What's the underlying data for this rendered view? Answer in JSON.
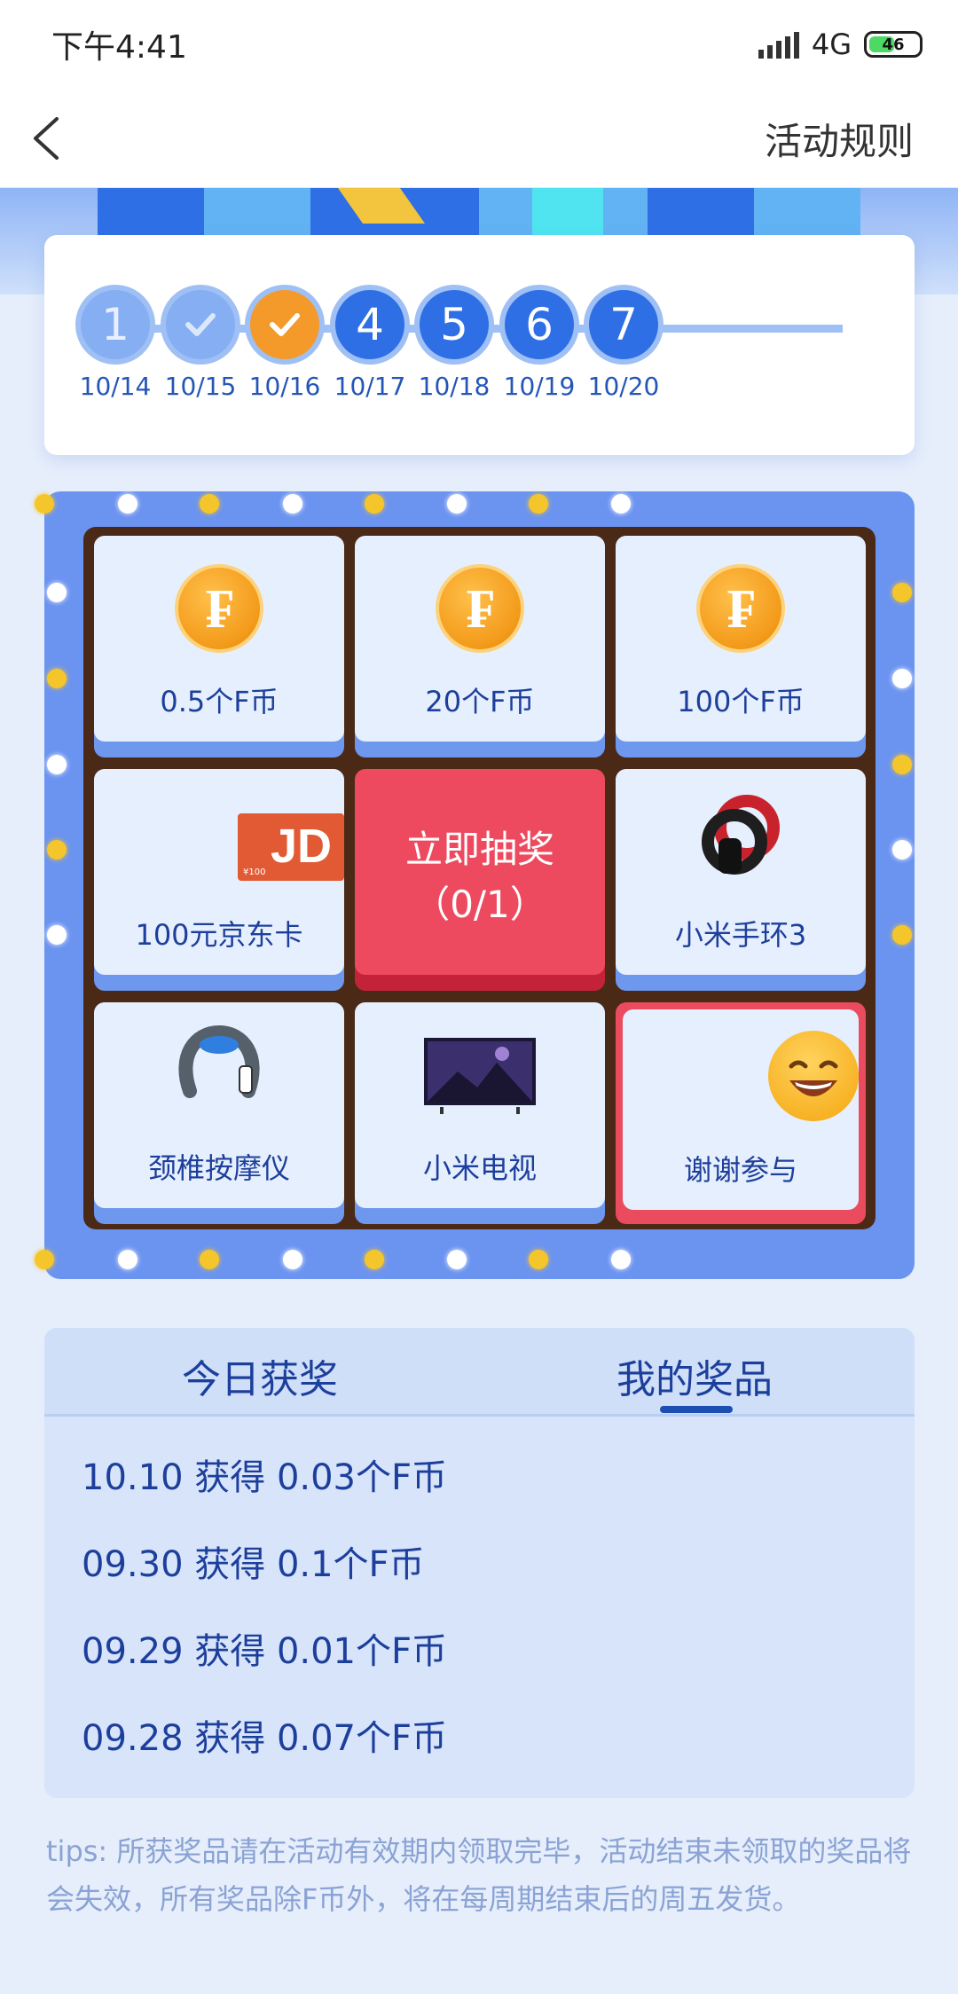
{
  "status_bar": {
    "time": "下午4:41",
    "network": "4G",
    "battery": "46"
  },
  "nav": {
    "rules_label": "活动规则"
  },
  "calendar": {
    "days": [
      {
        "num": "1",
        "date": "10/14",
        "state": "past-number"
      },
      {
        "num": "",
        "date": "10/15",
        "state": "past-check"
      },
      {
        "num": "",
        "date": "10/16",
        "state": "today-check"
      },
      {
        "num": "4",
        "date": "10/17",
        "state": "future"
      },
      {
        "num": "5",
        "date": "10/18",
        "state": "future"
      },
      {
        "num": "6",
        "date": "10/19",
        "state": "future"
      },
      {
        "num": "7",
        "date": "10/20",
        "state": "future"
      }
    ]
  },
  "lottery": {
    "prizes": [
      {
        "label": "0.5个F币",
        "icon": "coin-icon"
      },
      {
        "label": "20个F币",
        "icon": "coin-icon"
      },
      {
        "label": "100个F币",
        "icon": "coin-icon"
      },
      {
        "label": "100元京东卡",
        "icon": "jd-card-icon"
      },
      {
        "label": "小米手环3",
        "icon": "band-icon"
      },
      {
        "label": "颈椎按摩仪",
        "icon": "massager-icon"
      },
      {
        "label": "小米电视",
        "icon": "tv-icon"
      },
      {
        "label": "谢谢参与",
        "icon": "smile-icon"
      }
    ],
    "draw_button": {
      "line1": "立即抽奖",
      "line2": "（0/1）"
    },
    "coin_glyph": "₣",
    "jd_glyph": "JD",
    "jd_small": "¥100"
  },
  "prize_panel": {
    "tabs": [
      "今日获奖",
      "我的奖品"
    ],
    "active_tab": 1,
    "records": [
      "10.10 获得 0.03个F币",
      "09.30 获得 0.1个F币",
      "09.29 获得 0.01个F币",
      "09.28 获得 0.07个F币"
    ]
  },
  "tips": "tips: 所获奖品请在活动有效期内领取完毕，活动结束未领取的奖品将会失效，所有奖品除F币外，将在每周期结束后的周五发货。",
  "colors": {
    "primary_blue": "#2f6fe6",
    "board_blue": "#6b93f0",
    "draw_red": "#ed4a5f",
    "coin_orange": "#f39a1a",
    "text_blue": "#1d3f9c"
  }
}
